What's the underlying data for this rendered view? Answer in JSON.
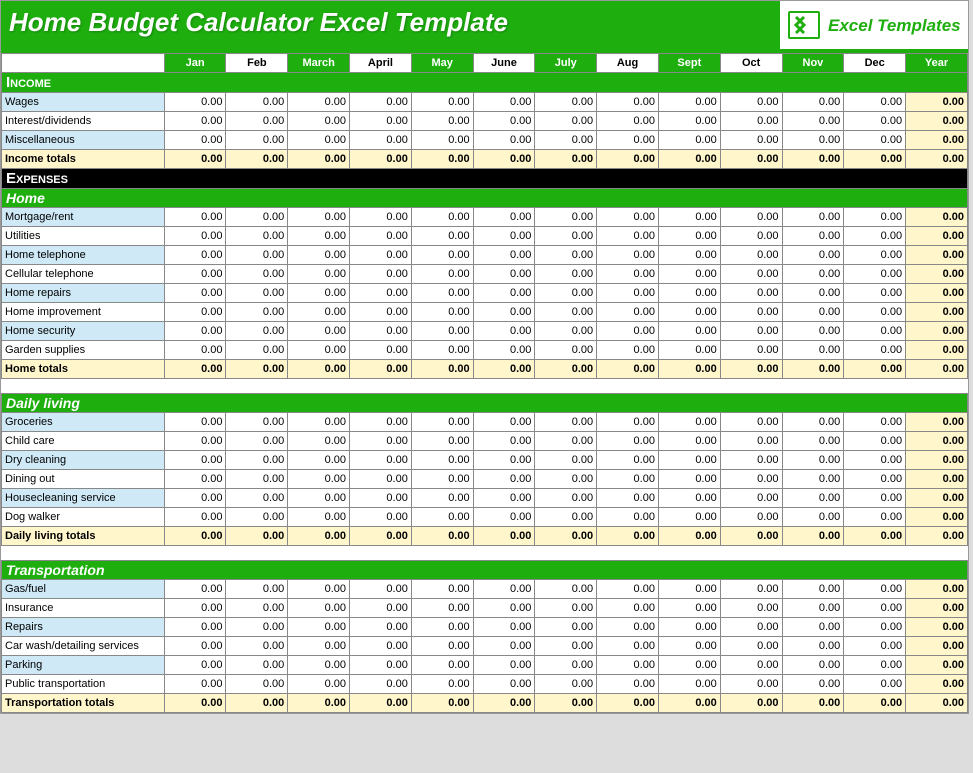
{
  "title": "Home Budget Calculator Excel Template",
  "brand": "Excel Templates",
  "months": [
    "Jan",
    "Feb",
    "March",
    "April",
    "May",
    "June",
    "July",
    "Aug",
    "Sept",
    "Oct",
    "Nov",
    "Dec",
    "Year"
  ],
  "white_header_indices": [
    1,
    3,
    5,
    7,
    9,
    11
  ],
  "section_income": "Income",
  "section_expenses": "Expenses",
  "zero": "0.00",
  "groups": [
    {
      "key": "income",
      "header": null,
      "rows": [
        "Wages",
        "Interest/dividends",
        "Miscellaneous"
      ],
      "total_label": "Income totals"
    },
    {
      "key": "home",
      "header": "Home",
      "rows": [
        "Mortgage/rent",
        "Utilities",
        "Home telephone",
        "Cellular telephone",
        "Home repairs",
        "Home improvement",
        "Home security",
        "Garden supplies"
      ],
      "total_label": "Home totals"
    },
    {
      "key": "daily",
      "header": "Daily living",
      "rows": [
        "Groceries",
        "Child care",
        "Dry cleaning",
        "Dining out",
        "Housecleaning service",
        "Dog walker"
      ],
      "total_label": "Daily living totals"
    },
    {
      "key": "transport",
      "header": "Transportation",
      "rows": [
        "Gas/fuel",
        "Insurance",
        "Repairs",
        "Car wash/detailing services",
        "Parking",
        "Public transportation"
      ],
      "total_label": "Transportation totals"
    }
  ]
}
